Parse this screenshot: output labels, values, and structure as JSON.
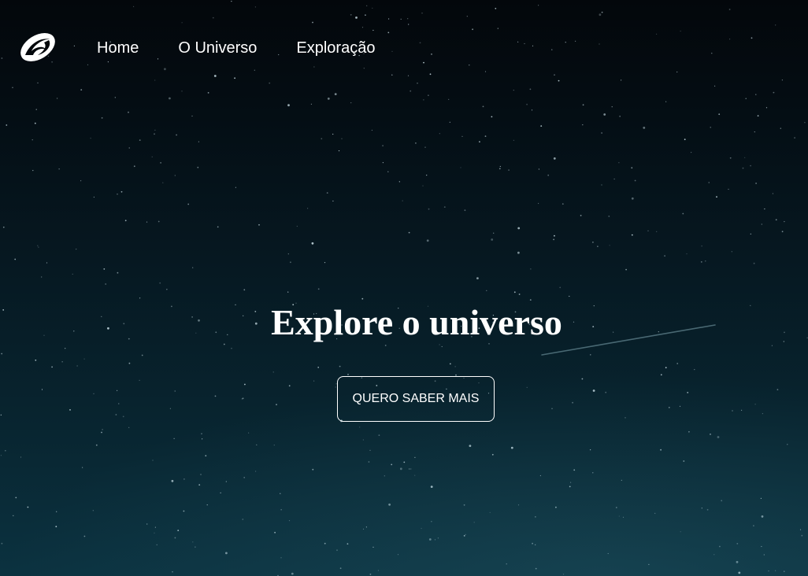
{
  "header": {
    "logo_icon": "spiral-galaxy-icon",
    "nav": {
      "items": [
        {
          "label": "Home"
        },
        {
          "label": "O Universo"
        },
        {
          "label": "Exploração"
        }
      ]
    }
  },
  "hero": {
    "title": "Explore o universo",
    "cta_label": "QUERO SABER MAIS"
  },
  "colors": {
    "text": "#ffffff",
    "sky_top": "#03070b",
    "sky_bottom": "#0b3240"
  }
}
